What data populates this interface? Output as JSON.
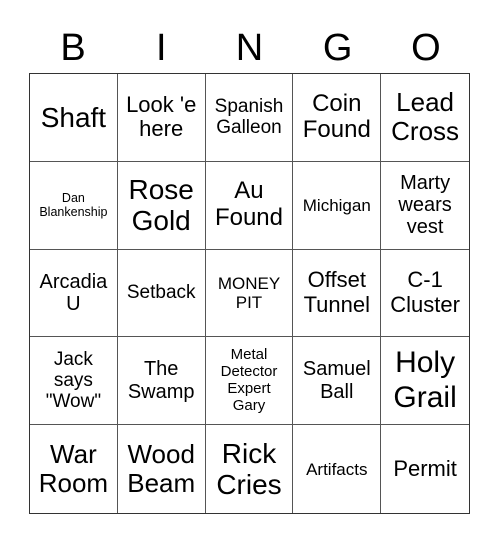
{
  "header": {
    "letters": [
      "B",
      "I",
      "N",
      "G",
      "O"
    ]
  },
  "card": {
    "rows": [
      [
        "Shaft",
        "Look 'e\nhere",
        "Spanish\nGalleon",
        "Coin\nFound",
        "Lead\nCross"
      ],
      [
        "Dan\nBlankenship",
        "Rose\nGold",
        "Au\nFound",
        "Michigan",
        "Marty\nwears\nvest"
      ],
      [
        "Arcadia\nU",
        "Setback",
        "MONEY\nPIT",
        "Offset\nTunnel",
        "C-1\nCluster"
      ],
      [
        "Jack\nsays\n\"Wow\"",
        "The\nSwamp",
        "Metal\nDetector\nExpert\nGary",
        "Samuel\nBall",
        "Holy\nGrail"
      ],
      [
        "War\nRoom",
        "Wood\nBeam",
        "Rick\nCries",
        "Artifacts",
        "Permit"
      ]
    ]
  }
}
